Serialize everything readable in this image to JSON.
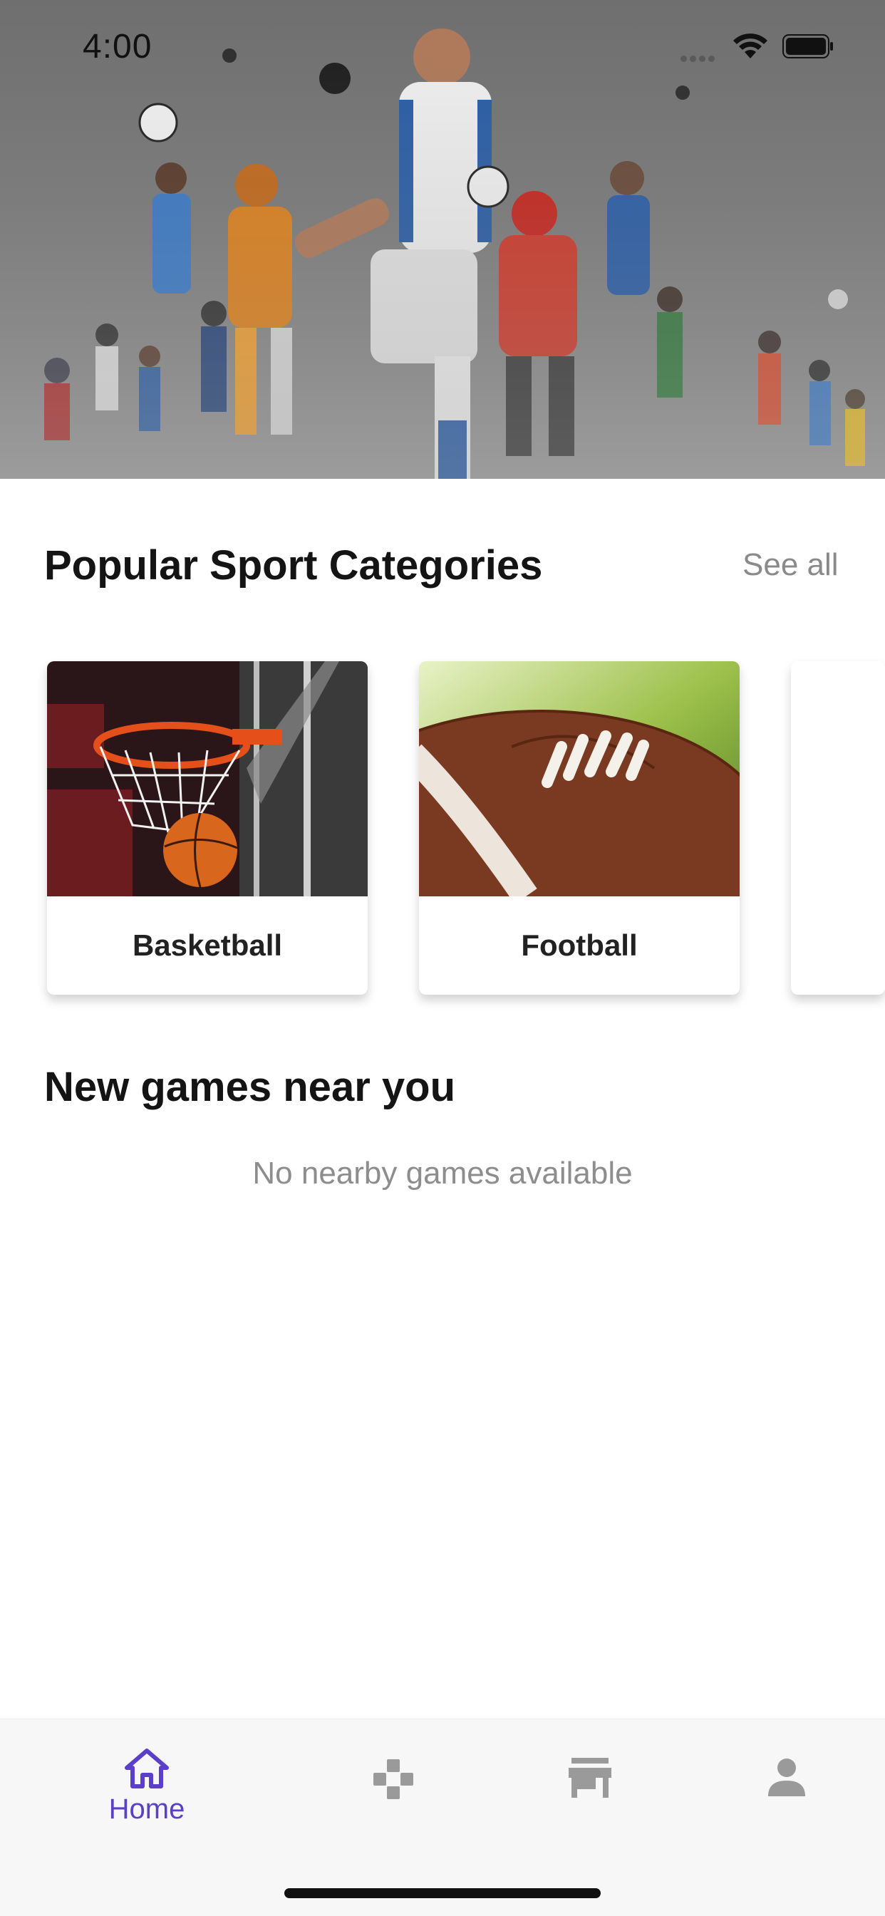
{
  "status_bar": {
    "time": "4:00"
  },
  "hero": {
    "image": "sports-collage-athletes"
  },
  "categories_section": {
    "title": "Popular Sport Categories",
    "see_all": "See all",
    "cards": [
      {
        "label": "Basketball",
        "image": "basketball-hoop"
      },
      {
        "label": "Football",
        "image": "american-football"
      },
      {
        "label": "",
        "image": "baseball-bat"
      }
    ]
  },
  "nearby_section": {
    "title": "New games near you",
    "empty_message": "No nearby games available"
  },
  "tab_bar": {
    "active_color": "#5b3fc8",
    "inactive_color": "#9a9a9a",
    "tabs": [
      {
        "label": "Home",
        "icon": "home-icon",
        "active": true
      },
      {
        "label": "",
        "icon": "gamepad-icon",
        "active": false
      },
      {
        "label": "",
        "icon": "store-icon",
        "active": false
      },
      {
        "label": "",
        "icon": "person-icon",
        "active": false
      }
    ]
  }
}
